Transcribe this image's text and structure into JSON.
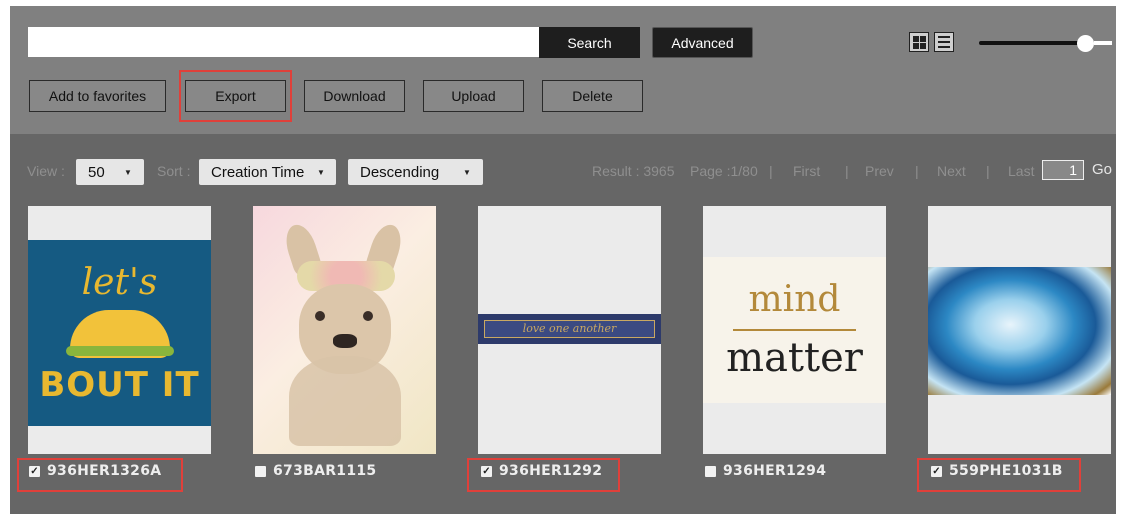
{
  "toolbar": {
    "search_placeholder": "",
    "search_label": "Search",
    "advanced_label": "Advanced",
    "add_favorites_label": "Add to favorites",
    "export_label": "Export",
    "download_label": "Download",
    "upload_label": "Upload",
    "delete_label": "Delete",
    "view_icons": [
      "grid-view-icon",
      "list-view-icon"
    ],
    "zoom_slider_level": 0.88
  },
  "filters": {
    "view_label": "View :",
    "view_value": "50",
    "sort_label": "Sort :",
    "sort_value": "Creation Time",
    "order_value": "Descending"
  },
  "pagination": {
    "result": "Result : 3965",
    "page": "Page :1/80",
    "sep": "|",
    "first": "First",
    "prev": "Prev",
    "next": "Next",
    "last": "Last",
    "page_input": "1",
    "go": "Go"
  },
  "cards": [
    {
      "code": "936HER1326A",
      "checked": true,
      "art_text_top": "let's",
      "art_text_bottom": "BOUT IT"
    },
    {
      "code": "673BAR1115",
      "checked": false
    },
    {
      "code": "936HER1292",
      "checked": true,
      "art_text": "love one another"
    },
    {
      "code": "936HER1294",
      "checked": false,
      "art_text_top": "mind",
      "art_text_bottom": "matter"
    },
    {
      "code": "559PHE1031B",
      "checked": true
    }
  ],
  "colors": {
    "toolbar_bg": "#808080",
    "content_bg": "#666666",
    "highlight": "#e0403a",
    "taco_bg": "#155a82",
    "taco_text": "#e8b830",
    "gold": "#b3893a"
  }
}
